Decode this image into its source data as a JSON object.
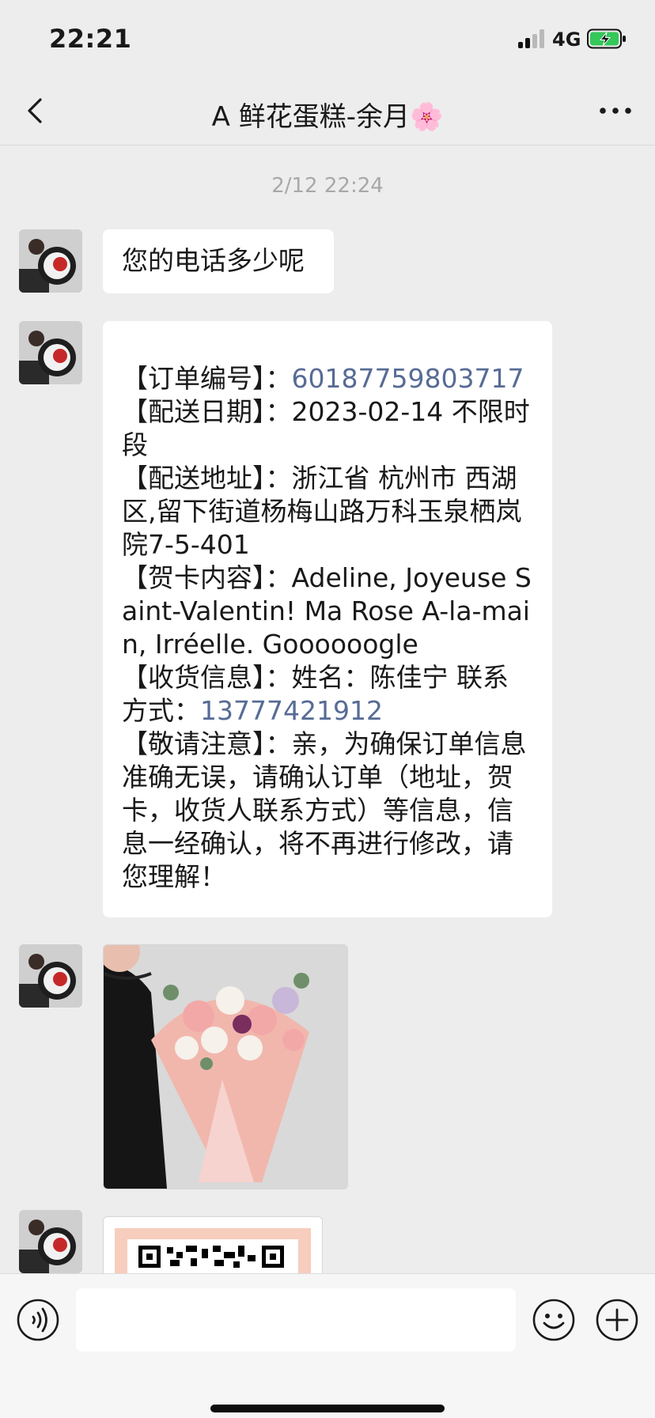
{
  "status_bar": {
    "time": "22:21",
    "network": "4G",
    "battery_charging": true,
    "colors": {
      "battery_fill": "#34c759"
    }
  },
  "nav": {
    "title": "A 鲜花蛋糕-余月🌸",
    "back_icon": "chevron-left-icon",
    "more_icon": "more-dots-icon"
  },
  "chat": {
    "timestamp": "2/12 22:24",
    "message_1": "您的电话多少呢",
    "order": {
      "order_no_label": "【订单编号】：",
      "order_no": "60187759803717",
      "date_label": "【配送日期】：",
      "date": "2023-02-14 不限时段",
      "address_label": "【配送地址】：",
      "address": "浙江省 杭州市 西湖区,留下街道杨梅山路万科玉泉栖岚院7-5-401",
      "card_label": "【贺卡内容】：",
      "card": "Adeline, Joyeuse Saint-Valentin! Ma Rose A-la-main, Irréelle. Goooooogle",
      "receiver_label": "【收货信息】：",
      "receiver_name_label": "姓名：",
      "receiver_name": "陈佳宁",
      "receiver_contact_label": " 联系方式：",
      "receiver_phone": "13777421912",
      "notice_label": "【敬请注意】：",
      "notice": "亲，为确保订单信息准确无误，请确认订单（地址，贺卡，收货人联系方式）等信息，信息一经确认，将不再进行修改，请您理解！"
    },
    "colors": {
      "link": "#576b95",
      "background": "#ededed",
      "bubble": "#ffffff"
    }
  },
  "input_bar": {
    "value": "",
    "voice_icon": "voice-icon",
    "emoji_icon": "emoji-icon",
    "plus_icon": "plus-icon"
  }
}
